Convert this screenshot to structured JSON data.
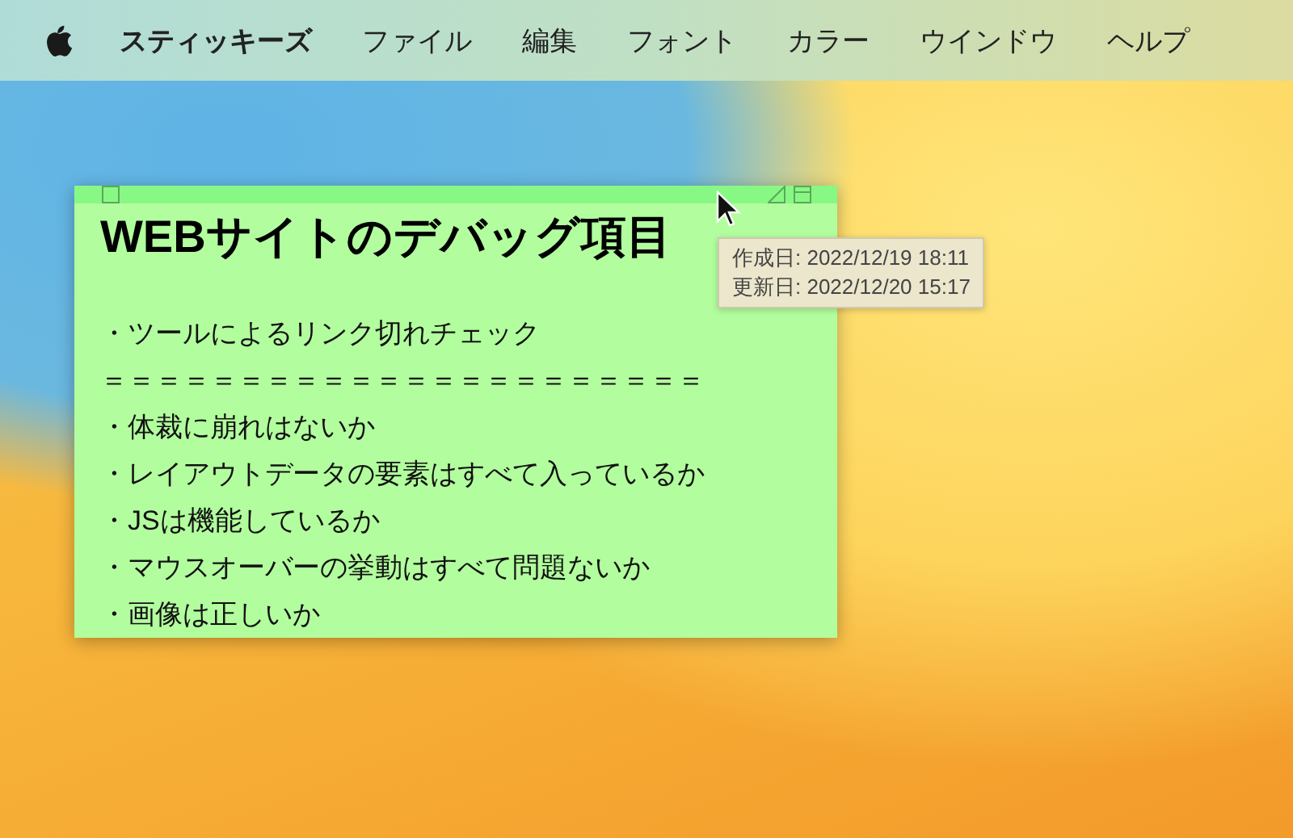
{
  "menu_bar": {
    "app_name": "スティッキーズ",
    "items": [
      "ファイル",
      "編集",
      "フォント",
      "カラー",
      "ウインドウ",
      "ヘルプ"
    ]
  },
  "note": {
    "title": "WEBサイトのデバッグ項目",
    "lines": [
      "・ツールによるリンク切れチェック",
      "＝＝＝＝＝＝＝＝＝＝＝＝＝＝＝＝＝＝＝＝＝＝",
      "・体裁に崩れはないか",
      "・レイアウトデータの要素はすべて入っているか",
      "・JSは機能しているか",
      "・マウスオーバーの挙動はすべて問題ないか",
      "・画像は正しいか"
    ]
  },
  "tooltip": {
    "lines": [
      "作成日: 2022/12/19 18:11",
      "更新日: 2022/12/20 15:17"
    ]
  }
}
